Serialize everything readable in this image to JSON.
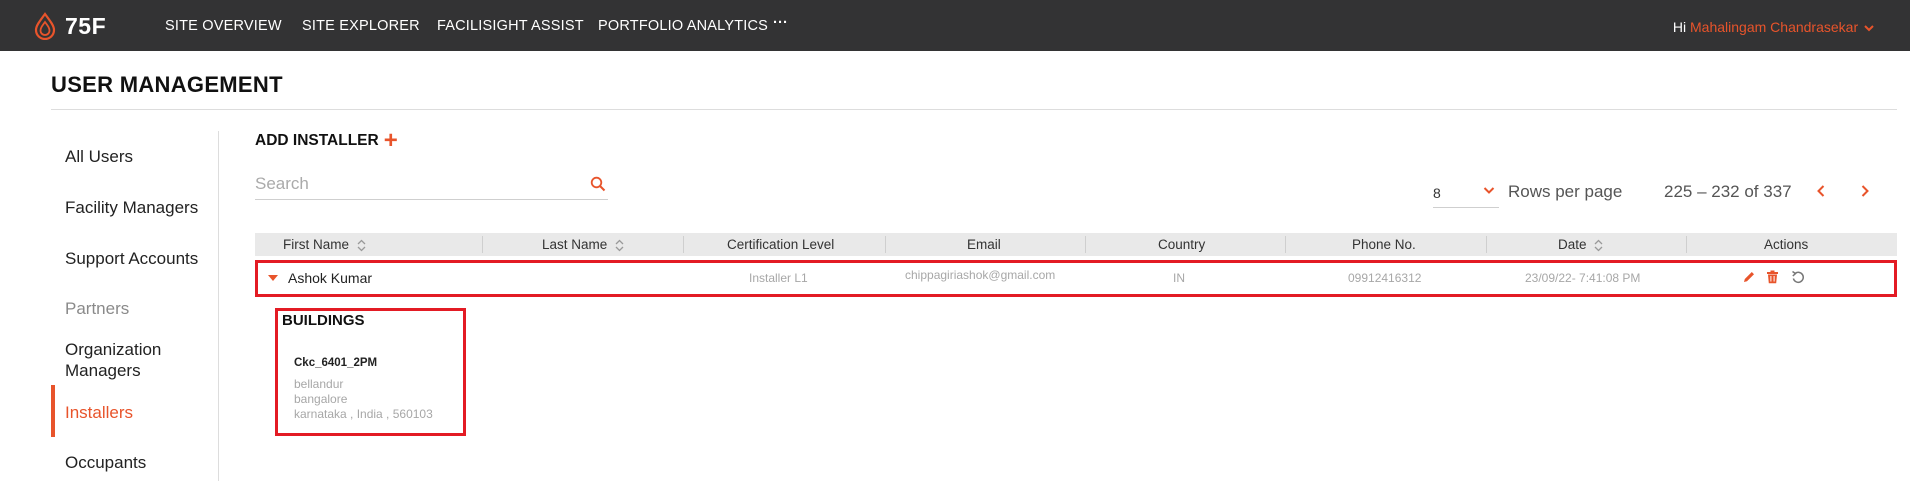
{
  "app": {
    "logo_text": "75F"
  },
  "nav": {
    "items": [
      {
        "label": "SITE OVERVIEW"
      },
      {
        "label": "SITE EXPLORER"
      },
      {
        "label": "FACILISIGHT ASSIST"
      },
      {
        "label": "PORTFOLIO ANALYTICS"
      },
      {
        "label": "···"
      }
    ],
    "greeting": "Hi",
    "user_name": "Mahalingam Chandrasekar"
  },
  "page": {
    "title": "USER MANAGEMENT"
  },
  "sidebar": {
    "items": [
      {
        "label": "All Users",
        "state": "normal"
      },
      {
        "label": "Facility Managers",
        "state": "normal"
      },
      {
        "label": "Support Accounts",
        "state": "normal"
      },
      {
        "label": "Partners",
        "state": "muted"
      },
      {
        "label": "Organization Managers",
        "state": "normal"
      },
      {
        "label": "Installers",
        "state": "active"
      },
      {
        "label": "Occupants",
        "state": "normal"
      }
    ]
  },
  "toolbar": {
    "add_label": "ADD INSTALLER",
    "add_icon": "+",
    "search_placeholder": "Search"
  },
  "pagination": {
    "rows_per_page_value": "8",
    "rows_per_page_label": "Rows per page",
    "range": "225 – 232 of 337"
  },
  "table": {
    "columns": [
      {
        "label": "First Name",
        "sortable": true
      },
      {
        "label": "Last Name",
        "sortable": true
      },
      {
        "label": "Certification Level",
        "sortable": false
      },
      {
        "label": "Email",
        "sortable": false
      },
      {
        "label": "Country",
        "sortable": false
      },
      {
        "label": "Phone No.",
        "sortable": false
      },
      {
        "label": "Date",
        "sortable": true
      },
      {
        "label": "Actions",
        "sortable": false
      }
    ],
    "rows": [
      {
        "first_name": "Ashok Kumar",
        "last_name": "",
        "certification": "Installer L1",
        "email": "chippagiriashok@gmail.com",
        "country": "IN",
        "phone": "09912416312",
        "date": "23/09/22- 7:41:08 PM",
        "expanded": true
      }
    ]
  },
  "buildings": {
    "title": "BUILDINGS",
    "items": [
      {
        "name": "Ckc_6401_2PM",
        "line1": "bellandur",
        "line2": "bangalore",
        "line3": "karnataka , India , 560103"
      }
    ]
  },
  "colors": {
    "accent": "#e8542b",
    "nav_bg": "#333334",
    "header_bg": "#e9e9e9",
    "highlight": "#e31b24"
  },
  "icons": {
    "logo": "flame-drop-icon",
    "search": "search-icon",
    "rows_dropdown": "chevron-down-icon",
    "prev": "chevron-left-icon",
    "next": "chevron-right-icon",
    "sort": "sort-icon",
    "expand": "caret-down-icon",
    "edit": "pencil-icon",
    "delete": "trash-icon",
    "reset": "undo-icon"
  }
}
